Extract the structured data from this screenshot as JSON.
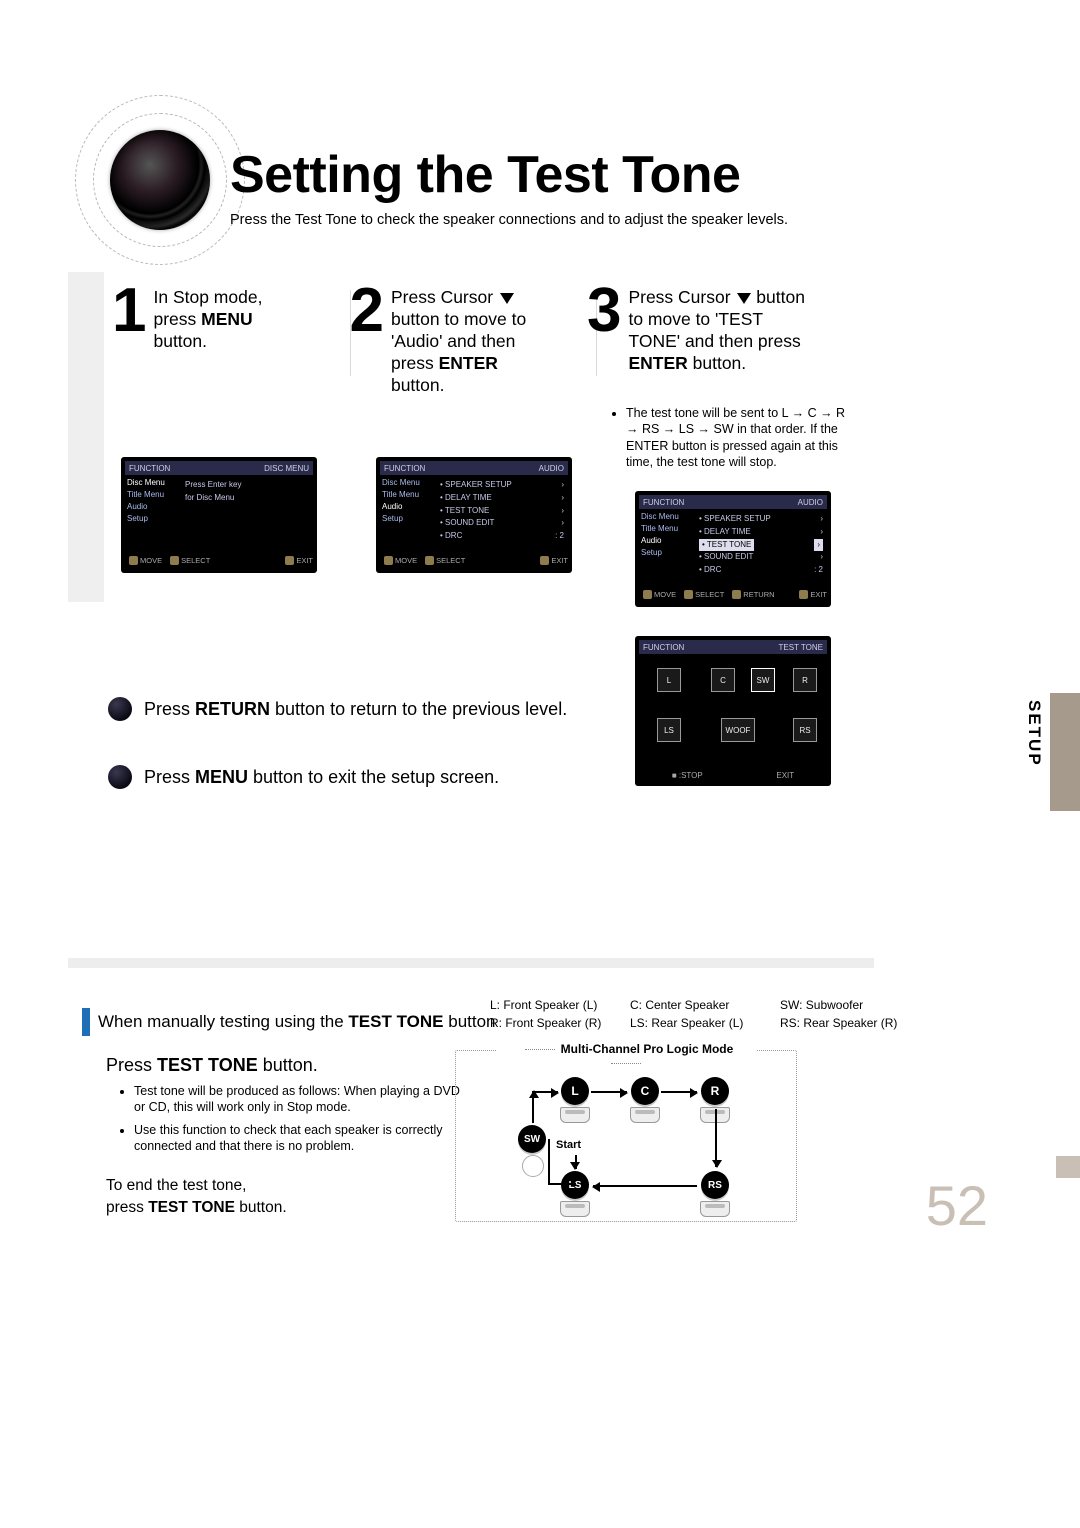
{
  "title": "Setting the Test Tone",
  "subtitle": "Press the Test Tone to check the speaker connections and to adjust the speaker levels.",
  "side_tab": "SETUP",
  "page_number": "52",
  "steps": {
    "s1": {
      "num": "1",
      "line1": "In Stop mode,",
      "line2a": "press ",
      "line2b": "MENU",
      "line3": "button."
    },
    "s2": {
      "num": "2",
      "line1a": "Press Cursor ",
      "line2": "button to move to",
      "line3": "'Audio' and then",
      "line4a": "press ",
      "line4b": "ENTER",
      "line4c": " button."
    },
    "s3": {
      "num": "3",
      "line1a": "Press Cursor ",
      "line1b": " button",
      "line2": "to move to 'TEST",
      "line3": "TONE' and then press",
      "line4a": "ENTER",
      "line4b": " button."
    }
  },
  "note3": "The test tone will be sent to L → C → R → RS → LS → SW in that order. If the ENTER button is pressed again at this time, the test tone will stop.",
  "return_line_a": "Press ",
  "return_line_b": "RETURN",
  "return_line_c": " button to return to the previous level.",
  "menu_line_a": "Press ",
  "menu_line_b": "MENU",
  "menu_line_c": " button to exit the setup screen.",
  "manual_heading_a": "When manually testing using the ",
  "manual_heading_b": "TEST TONE",
  "manual_heading_c": " button",
  "legend": {
    "l": "L: Front Speaker (L)",
    "c": "C: Center Speaker",
    "sw": "SW: Subwoofer",
    "r": "R: Front Speaker (R)",
    "ls": "LS: Rear Speaker (L)",
    "rs": "RS: Rear Speaker (R)"
  },
  "press_tt_a": "Press ",
  "press_tt_b": "TEST TONE",
  "press_tt_c": " button.",
  "tt_bullets": [
    "Test tone will be produced as follows: When playing a DVD or CD, this will work only in Stop mode.",
    "Use this function to check that each speaker is correctly connected and that there is no problem."
  ],
  "end_tt_a": "To end the test tone,",
  "end_tt_b": "press ",
  "end_tt_c": "TEST TONE",
  "end_tt_d": " button.",
  "mode_title": "Multi-Channel Pro Logic Mode",
  "start_label": "Start",
  "nodes": {
    "L": "L",
    "C": "C",
    "R": "R",
    "SW": "SW",
    "LS": "LS",
    "RS": "RS"
  },
  "osd": {
    "disc_menu_hdr_l": "FUNCTION",
    "disc_menu_hdr_r": "DISC MENU",
    "audio_hdr_r": "AUDIO",
    "test_hdr_r": "TEST TONE",
    "side_items": [
      "Disc Menu",
      "Title Menu",
      "Audio",
      "Setup"
    ],
    "main1a": "Press Enter key",
    "main1b": "for Disc Menu",
    "audio_items": [
      "SPEAKER SETUP",
      "DELAY TIME",
      "TEST TONE",
      "SOUND EDIT",
      "DRC"
    ],
    "drc_val": ": 2",
    "foot": [
      "MOVE",
      "SELECT",
      "EXIT"
    ],
    "foot3": [
      "MOVE",
      "SELECT",
      "RETURN",
      "EXIT"
    ],
    "foot4a": "■ :STOP",
    "foot4b": "EXIT",
    "spk_labels": [
      "L",
      "C",
      "R",
      "LS",
      "RS",
      "SW",
      "WOOF"
    ]
  }
}
